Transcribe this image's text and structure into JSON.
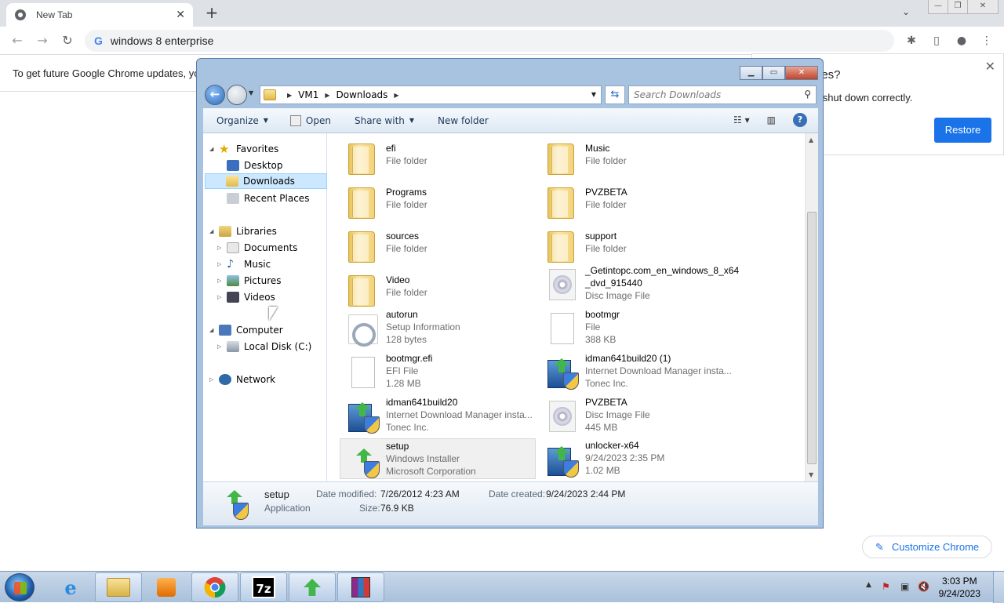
{
  "chrome": {
    "tab_title": "New Tab",
    "omnibox_text": "windows 8 enterprise",
    "update_text": "To get future Google Chrome updates, yo",
    "restore_question": "ges?",
    "restore_msg": "'t shut down correctly.",
    "restore_button": "Restore",
    "customize_label": "Customize Chrome"
  },
  "explorer": {
    "breadcrumb": [
      "VM1",
      "Downloads"
    ],
    "search_placeholder": "Search Downloads",
    "toolbar": {
      "organize": "Organize",
      "open": "Open",
      "share_with": "Share with",
      "new_folder": "New folder"
    },
    "nav": {
      "favorites": "Favorites",
      "desktop": "Desktop",
      "downloads": "Downloads",
      "recent_places": "Recent Places",
      "libraries": "Libraries",
      "documents": "Documents",
      "music": "Music",
      "pictures": "Pictures",
      "videos": "Videos",
      "computer": "Computer",
      "local_disk": "Local Disk (C:)",
      "network": "Network"
    },
    "files": [
      {
        "name": "efi",
        "line2": "File folder",
        "line3": "",
        "icon": "folder-icon"
      },
      {
        "name": "Music",
        "line2": "File folder",
        "line3": "",
        "icon": "folder-icon"
      },
      {
        "name": "Programs",
        "line2": "File folder",
        "line3": "",
        "icon": "folder-icon"
      },
      {
        "name": "PVZBETA",
        "line2": "File folder",
        "line3": "",
        "icon": "folder-icon"
      },
      {
        "name": "sources",
        "line2": "File folder",
        "line3": "",
        "icon": "folder-icon"
      },
      {
        "name": "support",
        "line2": "File folder",
        "line3": "",
        "icon": "folder-icon"
      },
      {
        "name": "Video",
        "line2": "File folder",
        "line3": "",
        "icon": "folder-icon"
      },
      {
        "name": "_Getintopc.com_en_windows_8_x64",
        "name2": "_dvd_915440",
        "line2": "Disc Image File",
        "line3": "",
        "icon": "disc-image-icon"
      },
      {
        "name": "autorun",
        "line2": "Setup Information",
        "line3": "128 bytes",
        "icon": "setup-info-icon"
      },
      {
        "name": "bootmgr",
        "line2": "File",
        "line3": "388 KB",
        "icon": "file-icon"
      },
      {
        "name": "bootmgr.efi",
        "line2": "EFI File",
        "line3": "1.28 MB",
        "icon": "file-icon"
      },
      {
        "name": "idman641build20 (1)",
        "line2": "Internet Download Manager insta...",
        "line3": "Tonec Inc.",
        "icon": "installer-icon"
      },
      {
        "name": "idman641build20",
        "line2": "Internet Download Manager insta...",
        "line3": "Tonec Inc.",
        "icon": "installer-icon"
      },
      {
        "name": "PVZBETA",
        "line2": "Disc Image File",
        "line3": "445 MB",
        "icon": "disc-image-icon"
      },
      {
        "name": "setup",
        "line2": "Windows Installer",
        "line3": "Microsoft Corporation",
        "icon": "installer-icon"
      },
      {
        "name": "unlocker-x64",
        "line2": "9/24/2023 2:35 PM",
        "line3": "1.02 MB",
        "icon": "installer-icon"
      }
    ],
    "details": {
      "name": "setup",
      "type": "Application",
      "modified_label": "Date modified:",
      "modified": "7/26/2012 4:23 AM",
      "created_label": "Date created:",
      "created": "9/24/2023 2:44 PM",
      "size_label": "Size:",
      "size": "76.9 KB"
    }
  },
  "taskbar": {
    "time": "3:03 PM",
    "date": "9/24/2023",
    "apps": [
      "explorer-icon",
      "internet-explorer-icon",
      "media-player-icon",
      "chrome-icon",
      "7zip-icon",
      "setup-icon",
      "winrar-icon"
    ]
  }
}
